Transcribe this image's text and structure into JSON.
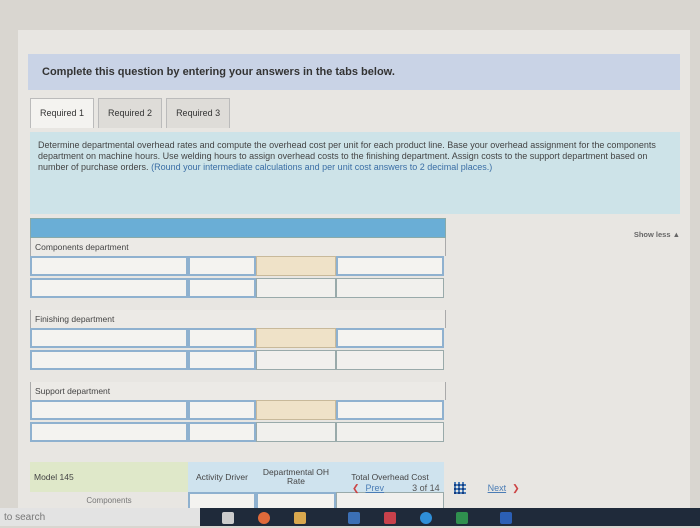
{
  "banner": {
    "text": "Complete this question by entering your answers in the tabs below."
  },
  "tabs": [
    {
      "label": "Required 1"
    },
    {
      "label": "Required 2"
    },
    {
      "label": "Required 3"
    }
  ],
  "instructions": {
    "main": "Determine departmental overhead rates and compute the overhead cost per unit for each product line. Base your overhead assignment for the components department on machine hours. Use welding hours to assign overhead costs to the finishing department. Assign costs to the support department based on number of purchase orders.",
    "rounding": "(Round your intermediate calculations and per unit cost answers to 2 decimal places.)"
  },
  "show_less": "Show less ▲",
  "sections": [
    {
      "label": "Components department"
    },
    {
      "label": "Finishing department"
    },
    {
      "label": "Support department"
    }
  ],
  "model_table": {
    "label": "Model 145",
    "col1": "Activity Driver",
    "col2": "Departmental OH Rate",
    "col3": "Total Overhead Cost",
    "sub_label": "Components"
  },
  "pager": {
    "prev": "Prev",
    "position": "3 of 14",
    "next": "Next"
  },
  "taskbar": {
    "search_placeholder": "to search"
  }
}
